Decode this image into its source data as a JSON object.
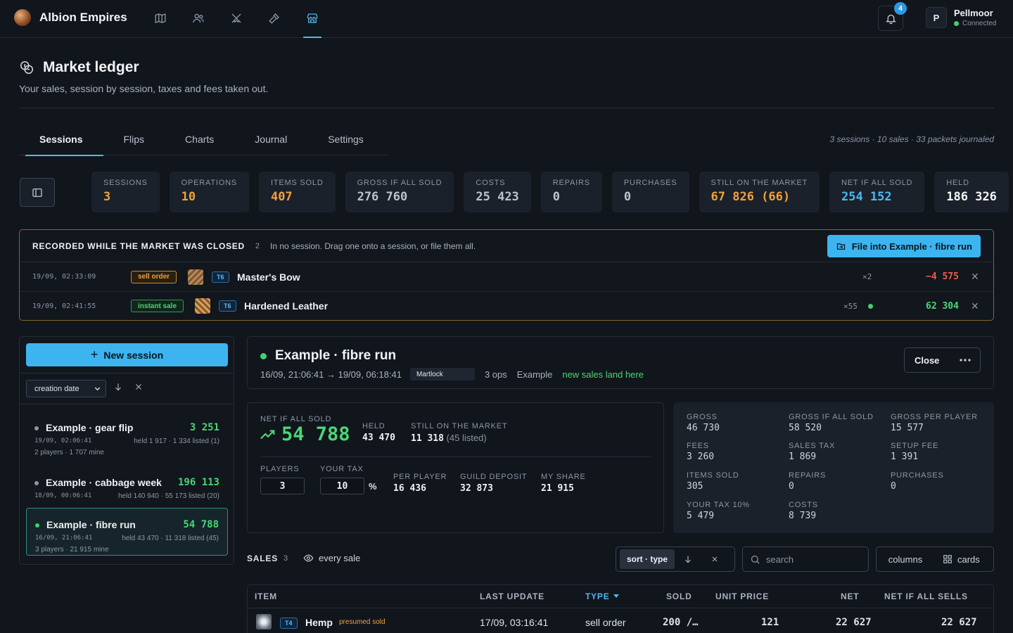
{
  "app": {
    "name": "Albion Empires",
    "nav_icons": [
      "map-icon",
      "users-icon",
      "crossed-swords-icon",
      "hammer-icon",
      "market-stall-icon"
    ],
    "notifications": "4",
    "user": {
      "avatar": "P",
      "name": "Pellmoor",
      "status": "Connected"
    }
  },
  "page": {
    "title": "Market ledger",
    "subtitle": "Your sales, session by session, taxes and fees taken out."
  },
  "tabs": {
    "items": [
      "Sessions",
      "Flips",
      "Charts",
      "Journal",
      "Settings"
    ],
    "active": "Sessions",
    "meta": "3 sessions · 10 sales · 33 packets journaled"
  },
  "stats": [
    {
      "label": "SESSIONS",
      "value": "3",
      "color": "#f0a23a"
    },
    {
      "label": "OPERATIONS",
      "value": "10",
      "color": "#f0a23a"
    },
    {
      "label": "ITEMS SOLD",
      "value": "407",
      "color": "#f0a23a"
    },
    {
      "label": "GROSS IF ALL SOLD",
      "value": "276 760",
      "color": "#bcc3ce"
    },
    {
      "label": "COSTS",
      "value": "25 423",
      "color": "#bcc3ce"
    },
    {
      "label": "REPAIRS",
      "value": "0",
      "color": "#bcc3ce"
    },
    {
      "label": "PURCHASES",
      "value": "0",
      "color": "#bcc3ce"
    },
    {
      "label": "STILL ON THE MARKET",
      "value": "67 826 (66)",
      "color": "#f0a23a"
    },
    {
      "label": "NET IF ALL SOLD",
      "value": "254 152",
      "color": "#4fb8f0"
    },
    {
      "label": "HELD",
      "value": "186 326",
      "color": "#f5f7fa"
    }
  ],
  "closed_market": {
    "title": "RECORDED WHILE THE MARKET WAS CLOSED",
    "count": "2",
    "hint": "In no session. Drag one onto a session, or file them all.",
    "file_button": "File into Example · fibre run",
    "rows": [
      {
        "time": "19/09, 02:33:09",
        "kind": "sell order",
        "tier": "T6",
        "item": "Master's Bow",
        "qty": "×2",
        "amount": "−4 575",
        "negative": true
      },
      {
        "time": "19/09, 02:41:55",
        "kind": "instant sale",
        "tier": "T6",
        "item": "Hardened Leather",
        "qty": "×55",
        "amount": "62 304",
        "negative": false
      }
    ]
  },
  "sidebar": {
    "new_session": "New session",
    "sort_value": "creation date",
    "sessions": [
      {
        "name": "Example · gear flip",
        "net": "3 251",
        "date": "19/09, 02:06:41",
        "held": "held 1 917 · 1 334 listed (1)",
        "players": "2 players · 1 707 mine",
        "active": false
      },
      {
        "name": "Example · cabbage week",
        "net": "196 113",
        "date": "18/09, 00:06:41",
        "held": "held 140 940 · 55 173 listed (20)",
        "players": "",
        "active": false
      },
      {
        "name": "Example · fibre run",
        "net": "54 788",
        "date": "16/09, 21:06:41",
        "held": "held 43 470 · 11 318 listed (45)",
        "players": "3 players · 21 915 mine",
        "active": true
      }
    ]
  },
  "session": {
    "title": "Example · fibre run",
    "range": "16/09, 21:06:41 → 19/09, 06:18:41",
    "city": "Martlock",
    "ops": "3 ops",
    "owner": "Example",
    "live_note": "new sales land here",
    "close_label": "Close",
    "net": {
      "net_label": "NET IF ALL SOLD",
      "net_value": "54 788",
      "held_label": "HELD",
      "held_value": "43 470",
      "market_label": "STILL ON THE MARKET",
      "market_value": "11 318",
      "market_listed": "(45 listed)",
      "players_label": "PLAYERS",
      "players_value": "3",
      "tax_label": "YOUR TAX",
      "tax_value": "10",
      "tax_unit": "%",
      "per_player_label": "PER PLAYER",
      "per_player_value": "16 436",
      "guild_label": "GUILD DEPOSIT",
      "guild_value": "32 873",
      "share_label": "MY SHARE",
      "share_value": "21 915"
    },
    "gross": [
      {
        "label": "GROSS",
        "value": "46 730"
      },
      {
        "label": "GROSS IF ALL SOLD",
        "value": "58 520"
      },
      {
        "label": "GROSS PER PLAYER",
        "value": "15 577"
      },
      {
        "label": "FEES",
        "value": "3 260"
      },
      {
        "label": "SALES TAX",
        "value": "1 869"
      },
      {
        "label": "SETUP FEE",
        "value": "1 391"
      },
      {
        "label": "ITEMS SOLD",
        "value": "305"
      },
      {
        "label": "REPAIRS",
        "value": "0"
      },
      {
        "label": "PURCHASES",
        "value": "0"
      },
      {
        "label": "YOUR TAX 10%",
        "value": "5 479"
      },
      {
        "label": "COSTS",
        "value": "8 739"
      }
    ]
  },
  "sales": {
    "label": "SALES",
    "count": "3",
    "filter": "every sale",
    "sort_chip": "sort · type",
    "search_placeholder": "search",
    "columns_label": "columns",
    "cards_label": "cards",
    "headers": [
      "ITEM",
      "LAST UPDATE",
      "TYPE",
      "SOLD",
      "UNIT PRICE",
      "NET",
      "NET IF ALL SELLS"
    ],
    "rows": [
      {
        "tier": "T4",
        "item": "Hemp",
        "note": "presumed sold",
        "updated": "17/09, 03:16:41",
        "type": "sell order",
        "sold": "200 /…",
        "unit_price": "121",
        "net": "22 627",
        "net_all": "22 627"
      }
    ]
  }
}
